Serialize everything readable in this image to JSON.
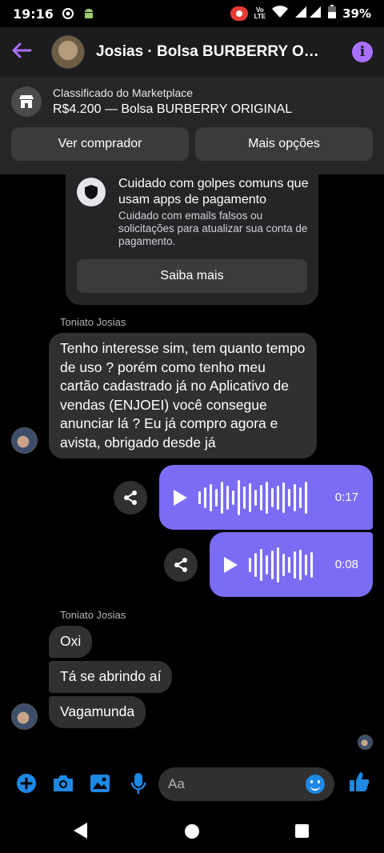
{
  "status_bar": {
    "time": "19:16",
    "network_label_top": "Vo",
    "network_label_bottom": "LTE",
    "battery": "39%"
  },
  "header": {
    "title": "Josias · Bolsa BURBERRY ORIGINAL",
    "back_icon": "back-arrow-icon",
    "info_icon": "info-icon",
    "accent_color": "#a970ff"
  },
  "marketplace": {
    "label": "Classificado do Marketplace",
    "listing": "R$4.200 — Bolsa BURBERRY ORIGINAL",
    "view_buyer": "Ver comprador",
    "more_options": "Mais opções"
  },
  "warning_card": {
    "title": "Cuidado com golpes comuns que usam apps de pagamento",
    "body": "Cuidado com emails falsos ou solicitações para atualizar sua conta de pagamento.",
    "learn_more": "Saiba mais"
  },
  "messages": {
    "sender_name": "Toniato Josias",
    "incoming_long": "Tenho interesse sim, tem quanto tempo de uso ? porém como tenho meu cartão cadastrado já no Aplicativo de vendas (ENJOEI) você consegue anunciar lá ? Eu já compro agora e avista, obrigado desde já",
    "voice_1_duration": "0:17",
    "voice_2_duration": "0:08",
    "sender_name_2": "Toniato Josias",
    "short_1": "Oxi",
    "short_2": "Tá se abrindo aí",
    "short_3": "Vagamunda",
    "voice_color": "#7b6cf6"
  },
  "composer": {
    "placeholder": "Aa"
  }
}
